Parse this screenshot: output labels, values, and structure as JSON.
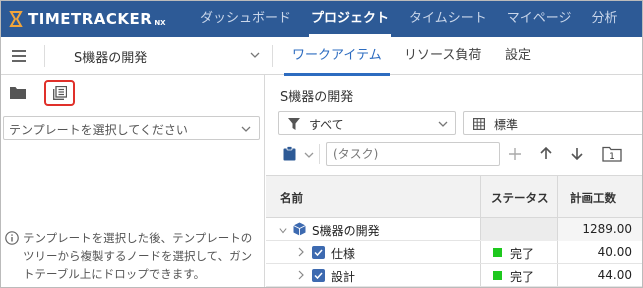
{
  "app": {
    "logo_text": "TIMETRACKER",
    "logo_suffix": "NX"
  },
  "nav": {
    "items": [
      {
        "label": "ダッシュボード",
        "active": false
      },
      {
        "label": "プロジェクト",
        "active": true
      },
      {
        "label": "タイムシート",
        "active": false
      },
      {
        "label": "マイページ",
        "active": false
      },
      {
        "label": "分析",
        "active": false
      }
    ]
  },
  "subbar": {
    "project_title": "S機器の開発",
    "tabs": [
      {
        "label": "ワークアイテム",
        "active": true
      },
      {
        "label": "リソース負荷",
        "active": false
      },
      {
        "label": "設定",
        "active": false
      }
    ]
  },
  "left_panel": {
    "template_select_placeholder": "テンプレートを選択してください",
    "info_text": "テンプレートを選択した後、テンプレートのツリーから複製するノードを選択して、ガントテーブル上にドロップできます。"
  },
  "right_panel": {
    "title": "S機器の開発",
    "filter_label": "すべて",
    "view_label": "標準",
    "task_placeholder": "(タスク)",
    "grid": {
      "columns": [
        "名前",
        "ステータス",
        "計画工数"
      ],
      "rows": [
        {
          "name": "S機器の開発",
          "status": "",
          "planned": "1289.00",
          "level": 0,
          "type": "project"
        },
        {
          "name": "仕様",
          "status": "完了",
          "planned": "40.00",
          "level": 1,
          "type": "task"
        },
        {
          "name": "設計",
          "status": "完了",
          "planned": "44.00",
          "level": 1,
          "type": "task"
        }
      ]
    }
  },
  "colors": {
    "nav_bg": "#2d5a96",
    "accent": "#2d6cc0",
    "status_done": "#1ec81e",
    "highlight_border": "#e0302a"
  }
}
